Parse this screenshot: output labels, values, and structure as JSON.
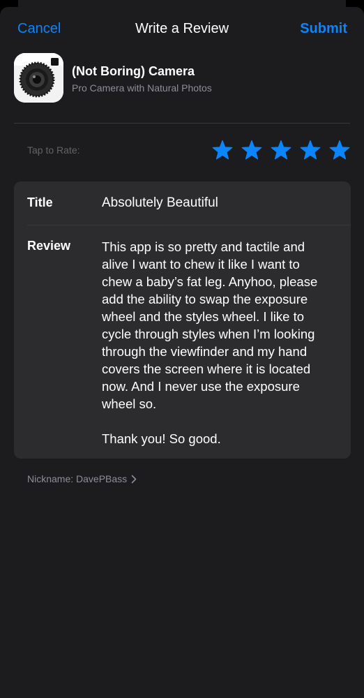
{
  "nav": {
    "cancel_label": "Cancel",
    "title": "Write a Review",
    "submit_label": "Submit"
  },
  "app": {
    "name": "(Not Boring) Camera",
    "subtitle": "Pro Camera with Natural Photos",
    "icon": "camera-lens-icon"
  },
  "rating": {
    "label": "Tap to Rate:",
    "value": 5,
    "max": 5,
    "icon": "star-icon",
    "color": "#0a84ff"
  },
  "form": {
    "title_label": "Title",
    "title_value": "Absolutely Beautiful",
    "review_label": "Review",
    "review_paragraphs": [
      "This app is so pretty and tactile and alive I want to chew it like I want to chew a baby’s fat leg. Anyhoo, please add the ability to swap the exposure wheel and the styles wheel. I like to cycle through styles when I’m looking through the viewfinder and my hand covers the screen where it is located now. And I never use the exposure wheel so.",
      "Thank you! So good."
    ]
  },
  "nickname": {
    "text": "Nickname: DavePBass",
    "icon": "chevron-right-icon"
  },
  "colors": {
    "accent": "#0a84ff",
    "background": "#1c1c1e",
    "card": "#2c2c2e",
    "secondary_text": "#8e8e93"
  }
}
